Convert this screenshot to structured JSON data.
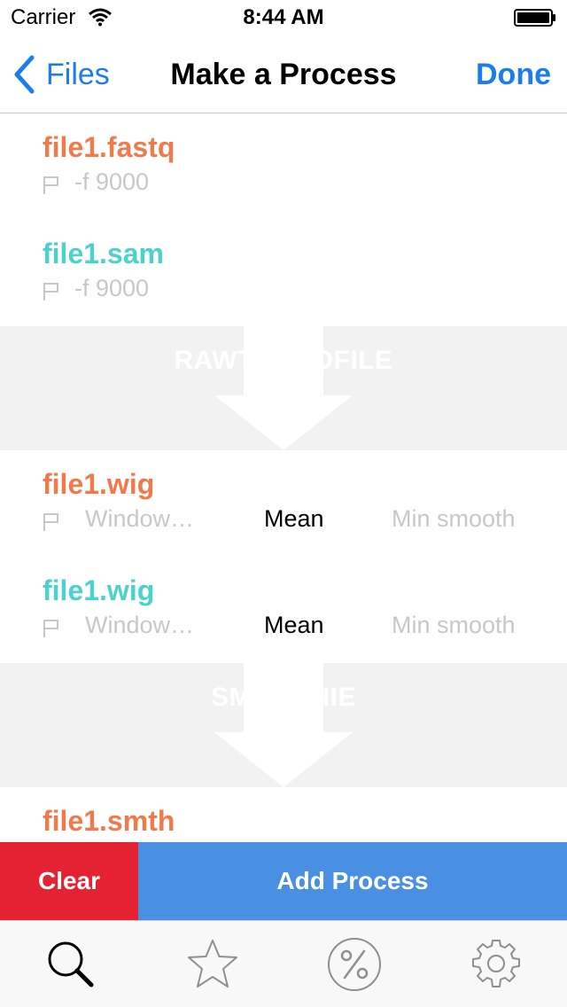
{
  "status_bar": {
    "carrier": "Carrier",
    "time": "8:44 AM"
  },
  "nav": {
    "back_label": "Files",
    "title": "Make a Process",
    "done_label": "Done"
  },
  "files": [
    {
      "name": "file1.fastq",
      "color": "#f07a4a",
      "param": "-f 9000"
    },
    {
      "name": "file1.sam",
      "color": "#4bd2cc",
      "param": "-f 9000"
    }
  ],
  "process_1": {
    "label": "RAWTOPROFILE"
  },
  "wig_files": [
    {
      "name": "file1.wig",
      "color": "#f07a4a",
      "window": "Window…",
      "mean": "Mean",
      "min_smooth": "Min smooth"
    },
    {
      "name": "file1.wig",
      "color": "#4bd2cc",
      "window": "Window…",
      "mean": "Mean",
      "min_smooth": "Min smooth"
    }
  ],
  "process_2": {
    "label": "SMOOTHIE"
  },
  "smth_file": {
    "name": "file1.smth",
    "color": "#f07a4a"
  },
  "actions": {
    "clear_label": "Clear",
    "add_process_label": "Add Process",
    "clear_color": "#e42232",
    "add_color": "#4a90e2"
  },
  "tabs": [
    {
      "icon": "search-icon",
      "selected": true
    },
    {
      "icon": "star-icon",
      "selected": false
    },
    {
      "icon": "percent-icon",
      "selected": false
    },
    {
      "icon": "gear-icon",
      "selected": false
    }
  ],
  "colors": {
    "accent": "#1a7cf0",
    "orange": "#f07a4a",
    "teal": "#4bd2cc"
  }
}
